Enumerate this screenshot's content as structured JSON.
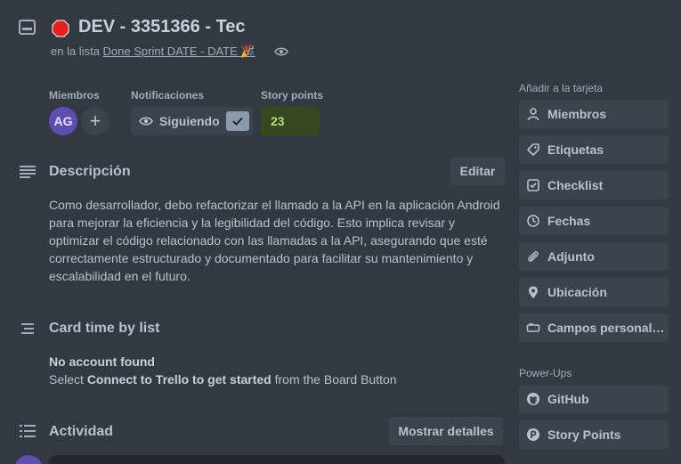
{
  "card": {
    "title": "DEV - 3351366 - Tec",
    "in_list_prefix": "en la lista",
    "list_name": "Done Sprint DATE - DATE 🎉"
  },
  "fields": {
    "members_label": "Miembros",
    "member_initials": "AG",
    "add_member": "+",
    "notifications_label": "Notificaciones",
    "following_label": "Siguiendo",
    "story_points_label": "Story points",
    "story_points_value": "23"
  },
  "description": {
    "title": "Descripción",
    "edit_label": "Editar",
    "text": "Como desarrollador, debo refactorizar el llamado a la API en la aplicación Android para mejorar la eficiencia y la legibilidad del código. Esto implica revisar y optimizar el código relacionado con las llamadas a la API, asegurando que esté correctamente estructurado y documentado para facilitar su mantenimiento y escalabilidad en el futuro."
  },
  "card_time": {
    "title": "Card time by list",
    "no_account": "No account found",
    "select_prefix": "Select ",
    "connect_text": "Connect to Trello to get started",
    "select_suffix": " from the Board Button"
  },
  "activity": {
    "title": "Actividad",
    "show_details": "Mostrar detalles"
  },
  "sidebar": {
    "add_to_card_label": "Añadir a la tarjeta",
    "items": [
      {
        "label": "Miembros",
        "icon": "person-icon"
      },
      {
        "label": "Etiquetas",
        "icon": "tag-icon"
      },
      {
        "label": "Checklist",
        "icon": "checkbox-icon"
      },
      {
        "label": "Fechas",
        "icon": "clock-icon"
      },
      {
        "label": "Adjunto",
        "icon": "paperclip-icon"
      },
      {
        "label": "Ubicación",
        "icon": "location-pin-icon"
      },
      {
        "label": "Campos personalizados",
        "icon": "custom-fields-icon"
      }
    ],
    "powerups_label": "Power-Ups",
    "powerups": [
      {
        "label": "GitHub",
        "icon": "github-icon"
      },
      {
        "label": "Story Points",
        "icon": "story-points-icon"
      }
    ]
  },
  "colors": {
    "background": "#323940",
    "button": "#3b444c",
    "text": "#b6c2cf",
    "avatar": "#5e4db2",
    "story_points_bg": "#37471f",
    "story_points_text": "#b3df72",
    "stop_red": "#e2211c"
  }
}
